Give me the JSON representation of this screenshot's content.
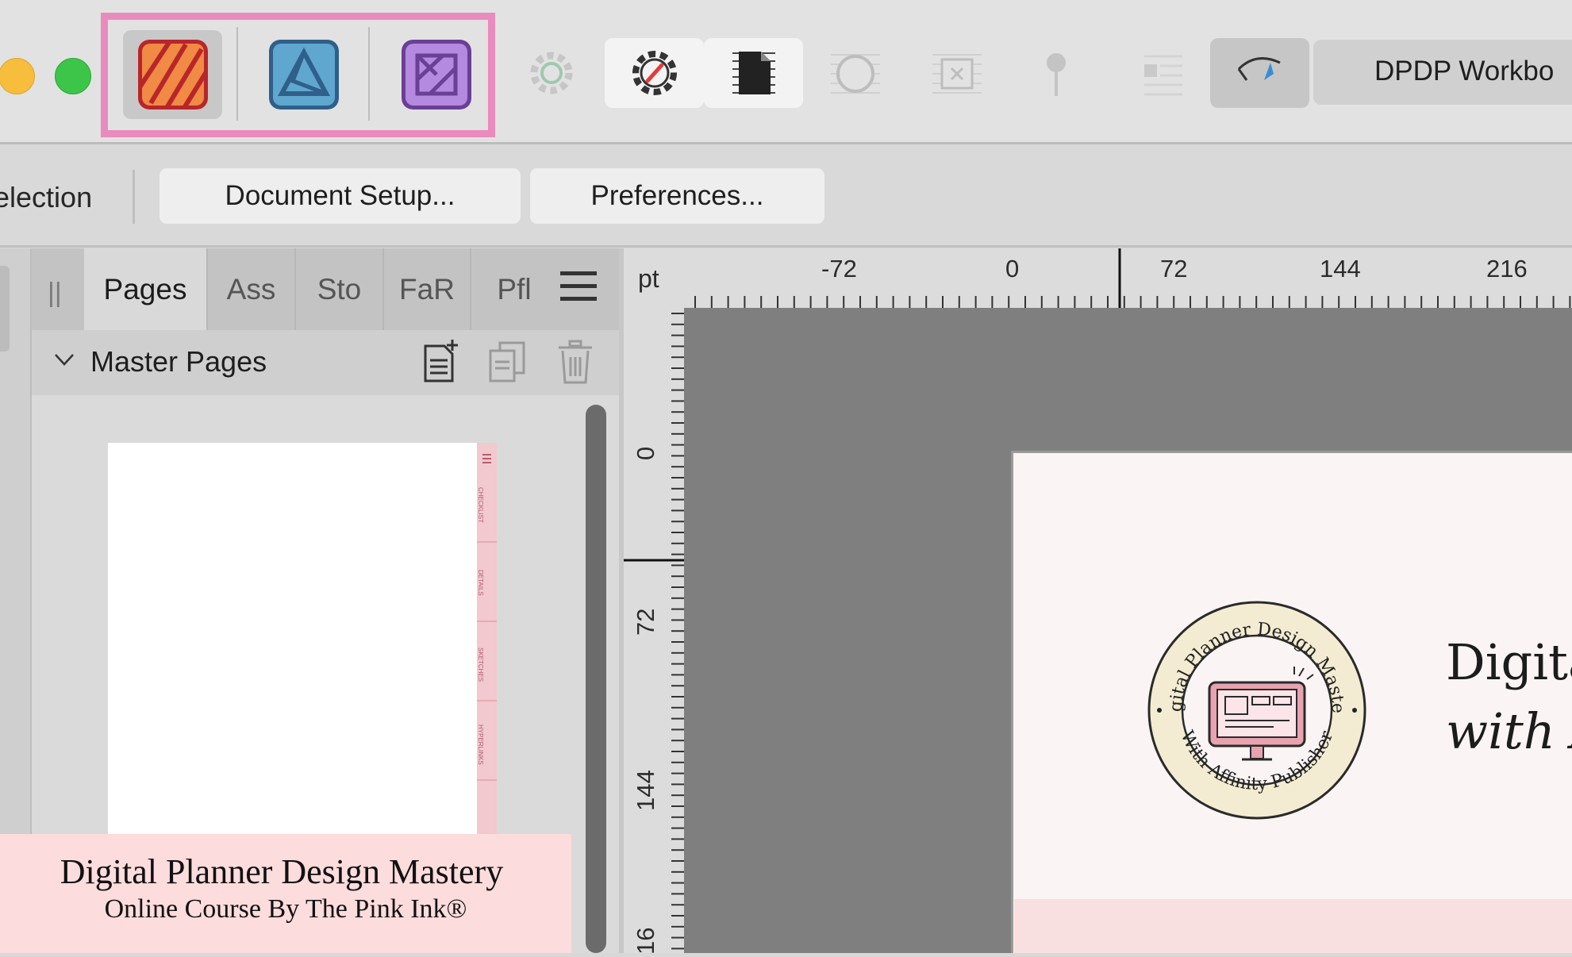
{
  "toolbar": {
    "personas": [
      {
        "name": "Publisher Persona",
        "color": "#e6583a"
      },
      {
        "name": "Designer Persona",
        "color": "#4aa3c8"
      },
      {
        "name": "Photo Persona",
        "color": "#a678d6"
      }
    ],
    "document_tab_label": "DPDP Workbo"
  },
  "context_bar": {
    "selection_label": "election",
    "document_setup_label": "Document Setup...",
    "preferences_label": "Preferences..."
  },
  "panel": {
    "grip": "||",
    "tabs": [
      "Pages",
      "Ass",
      "Sto",
      "FaR",
      "Pfl"
    ],
    "active_tab": "Pages",
    "master_pages_label": "Master Pages",
    "thumb_tab_labels": [
      "CHECKLIST",
      "DETAILS",
      "SKETCHES",
      "HYPERLINKS"
    ]
  },
  "rulers": {
    "units": "pt",
    "horizontal_labels": [
      "-72",
      "0",
      "72",
      "144",
      "216"
    ],
    "vertical_labels": [
      "0",
      "72",
      "144",
      "16"
    ]
  },
  "document": {
    "badge_ring_top": "Digital Planner Design Mastery",
    "badge_ring_bottom": "With Affinity Publisher",
    "title_line_1": "Digita",
    "title_line_2": "with A"
  },
  "banner": {
    "title": "Digital Planner Design Mastery",
    "subtitle": "Online Course By The Pink Ink®"
  },
  "colors": {
    "highlight": "#e98bbd",
    "banner_bg": "#fcdcdc",
    "page_bg": "#fbf4f4"
  }
}
